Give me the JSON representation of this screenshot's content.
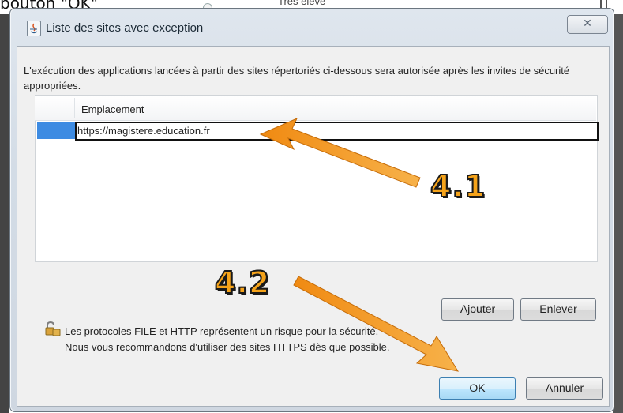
{
  "top_caption": {
    "text": "bouton \"OK\"",
    "behind_text": "Très élevé"
  },
  "dialog": {
    "title": "Liste des sites avec exception",
    "close_label": "✕",
    "description": "L'exécution des applications lancées à partir des sites répertoriés ci-dessous sera autorisée après les invites de sécurité appropriées.",
    "table": {
      "header": "Emplacement",
      "rows": [
        {
          "location": "https://magistere.education.fr"
        }
      ]
    },
    "buttons": {
      "add": "Ajouter",
      "remove": "Enlever",
      "ok": "OK",
      "cancel": "Annuler"
    },
    "warning": {
      "line1": "Les protocoles FILE et HTTP représentent un risque pour la sécurité.",
      "line2": "Nous vous recommandons d'utiliser des sites HTTPS dès que possible."
    }
  },
  "annotations": {
    "label_1": "4.1",
    "label_2": "4.2",
    "arrow_color": "#f5a31a"
  },
  "icons": {
    "title": "java-applet-icon",
    "close": "close-icon",
    "lock": "padlock-icon"
  }
}
